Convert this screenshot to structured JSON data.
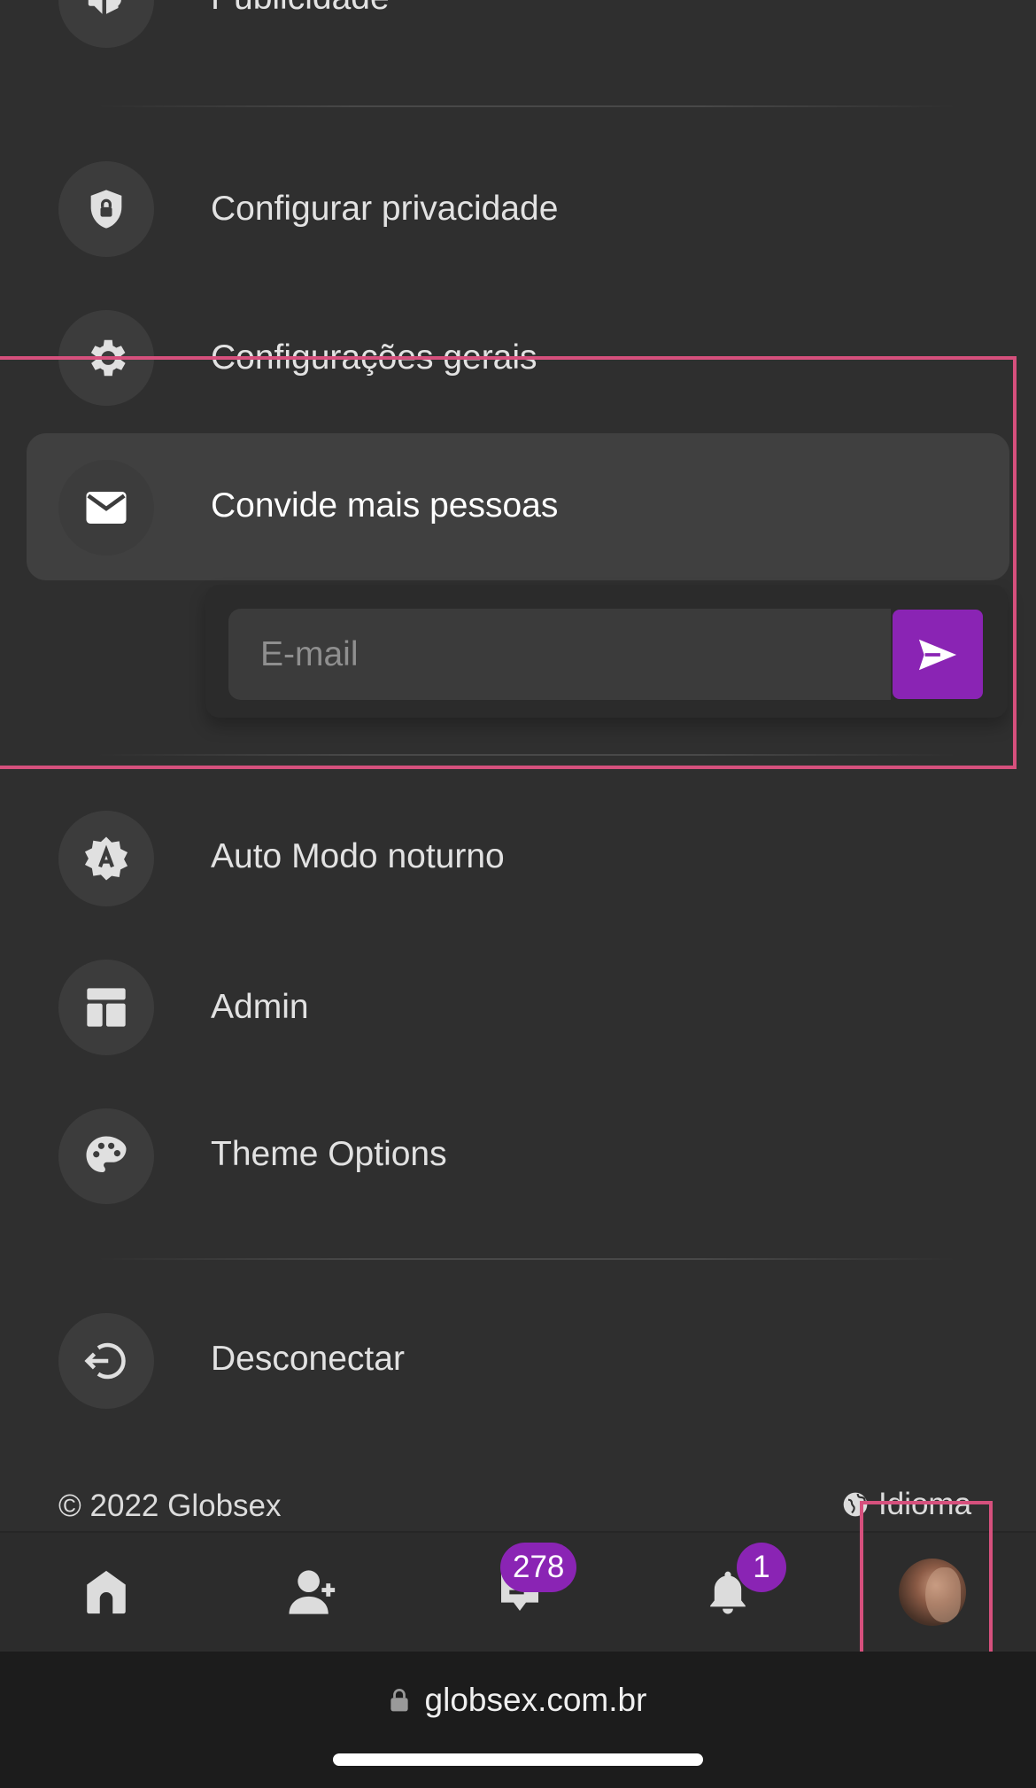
{
  "menu": {
    "items": [
      {
        "label": "Publicidade",
        "icon": "megaphone-icon"
      },
      {
        "label": "Configurar privacidade",
        "icon": "shield-lock-icon"
      },
      {
        "label": "Configurações gerais",
        "icon": "gear-icon"
      },
      {
        "label": "Convide mais pessoas",
        "icon": "envelope-icon"
      },
      {
        "label": "Auto Modo noturno",
        "icon": "auto-night-mode-icon"
      },
      {
        "label": "Admin",
        "icon": "dashboard-layout-icon"
      },
      {
        "label": "Theme Options",
        "icon": "palette-icon"
      },
      {
        "label": "Desconectar",
        "icon": "logout-icon"
      }
    ]
  },
  "invite": {
    "email_placeholder": "E-mail",
    "email_value": "",
    "send_icon": "send-icon"
  },
  "footer": {
    "copyright": "© 2022 Globsex",
    "language_label": "Idioma",
    "language_icon": "globe-icon"
  },
  "bottom_nav": {
    "items": [
      {
        "name": "home",
        "icon": "home-icon"
      },
      {
        "name": "friend-requests",
        "icon": "add-user-icon"
      },
      {
        "name": "messages",
        "icon": "chat-icon",
        "badge": "278"
      },
      {
        "name": "notifications",
        "icon": "bell-icon",
        "badge": "1"
      },
      {
        "name": "profile",
        "icon": "avatar"
      }
    ]
  },
  "browser": {
    "url": "globsex.com.br",
    "lock_icon": "lock-icon"
  },
  "colors": {
    "background": "#2f2f2f",
    "accent": "#8a24b4",
    "highlight": "#d6507d",
    "text": "#e2e2e2"
  }
}
